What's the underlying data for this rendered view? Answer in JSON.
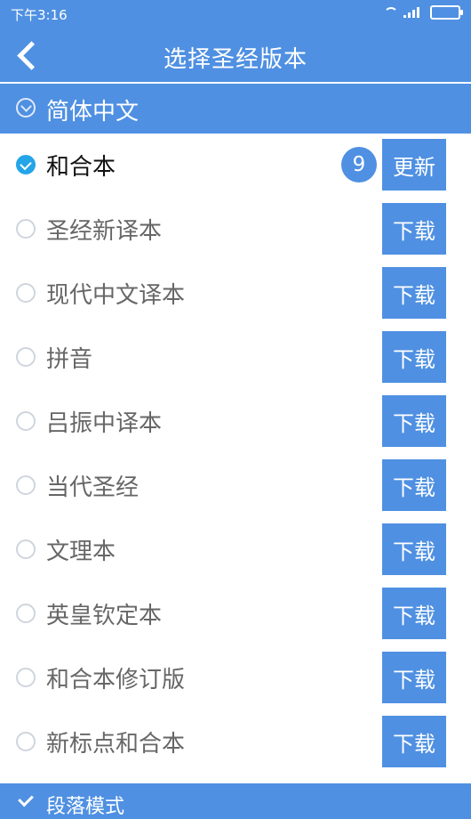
{
  "status": {
    "time": "下午3:16"
  },
  "header": {
    "title": "选择圣经版本"
  },
  "section": {
    "label": "简体中文"
  },
  "items": [
    {
      "label": "和合本",
      "selected": true,
      "action": "更新",
      "badge": "9"
    },
    {
      "label": "圣经新译本",
      "selected": false,
      "action": "下载"
    },
    {
      "label": "现代中文译本",
      "selected": false,
      "action": "下载"
    },
    {
      "label": "拼音",
      "selected": false,
      "action": "下载"
    },
    {
      "label": "吕振中译本",
      "selected": false,
      "action": "下载"
    },
    {
      "label": "当代圣经",
      "selected": false,
      "action": "下载"
    },
    {
      "label": "文理本",
      "selected": false,
      "action": "下载"
    },
    {
      "label": "英皇钦定本",
      "selected": false,
      "action": "下载"
    },
    {
      "label": "和合本修订版",
      "selected": false,
      "action": "下载"
    },
    {
      "label": "新标点和合本",
      "selected": false,
      "action": "下载"
    }
  ],
  "footer": {
    "label": "段落模式"
  }
}
